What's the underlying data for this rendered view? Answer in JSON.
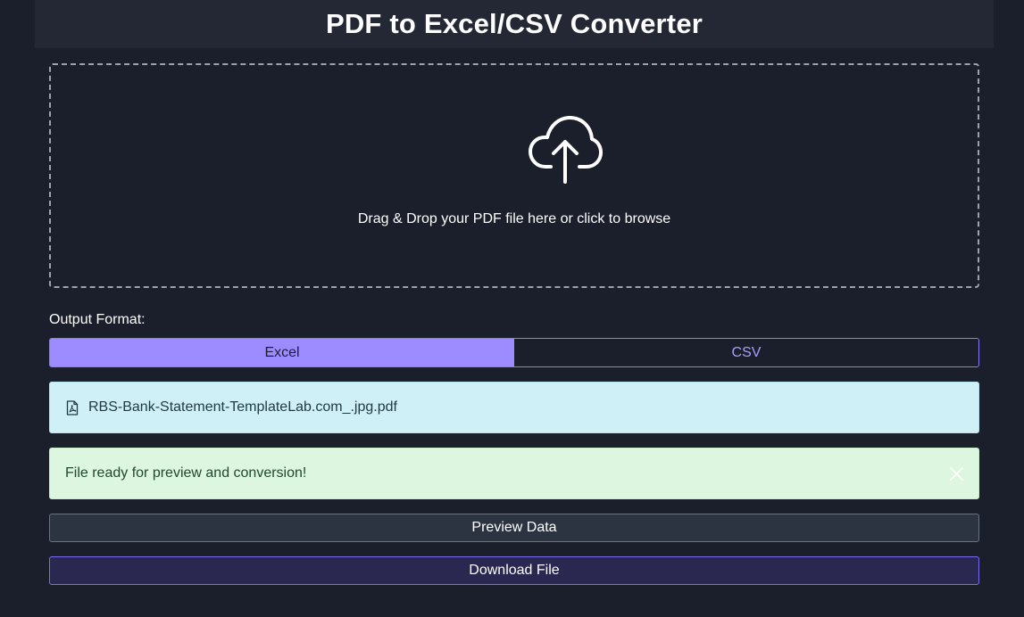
{
  "header": {
    "title": "PDF to Excel/CSV Converter"
  },
  "dropzone": {
    "icon": "cloud-upload-icon",
    "text": "Drag & Drop your PDF file here or click to browse"
  },
  "format": {
    "label": "Output Format:",
    "options": [
      "Excel",
      "CSV"
    ],
    "selected": "Excel"
  },
  "file": {
    "icon": "pdf-file-icon",
    "name": "RBS-Bank-Statement-TemplateLab.com_.jpg.pdf"
  },
  "alert": {
    "message": "File ready for preview and conversion!",
    "close_icon": "close-icon"
  },
  "actions": {
    "preview_label": "Preview Data",
    "download_label": "Download File"
  },
  "colors": {
    "background": "#1b1f2b",
    "accent": "#9d8cff",
    "info_bg": "#cff0f6",
    "success_bg": "#dcf6e0"
  }
}
